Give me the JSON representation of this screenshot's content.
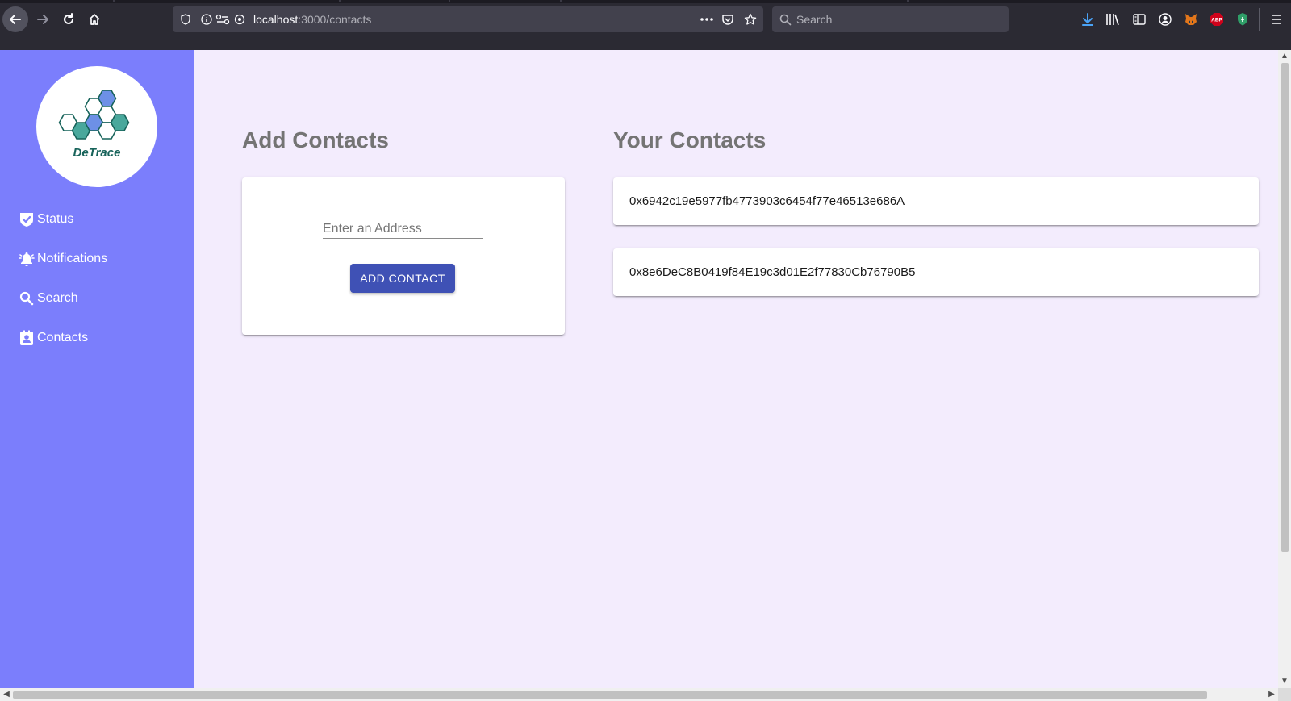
{
  "browser": {
    "url_host": "localhost",
    "url_path": ":3000/contacts",
    "search_placeholder": "Search",
    "extensions": [
      "download-icon",
      "library-icon",
      "sidebar-icon",
      "account-icon",
      "metamask-fox-icon",
      "adblock-abp-icon",
      "shield-extension-icon",
      "menu-icon"
    ],
    "abp_label": "ABP"
  },
  "app": {
    "name": "DeTrace",
    "colors": {
      "sidebar": "#7b7efc",
      "background": "#f3ecfd",
      "button": "#3f51b5",
      "heading": "#747474"
    }
  },
  "sidebar": {
    "items": [
      {
        "label": "Status",
        "icon": "check-shield-icon"
      },
      {
        "label": "Notifications",
        "icon": "bell-icon"
      },
      {
        "label": "Search",
        "icon": "search-icon"
      },
      {
        "label": "Contacts",
        "icon": "contact-card-icon"
      }
    ]
  },
  "add_contacts": {
    "title": "Add Contacts",
    "input_placeholder": "Enter an Address",
    "input_value": "",
    "button_label": "ADD CONTACT"
  },
  "your_contacts": {
    "title": "Your Contacts",
    "items": [
      "0x6942c19e5977fb4773903c6454f77e46513e686A",
      "0x8e6DeC8B0419f84E19c3d01E2f77830Cb76790B5"
    ]
  }
}
